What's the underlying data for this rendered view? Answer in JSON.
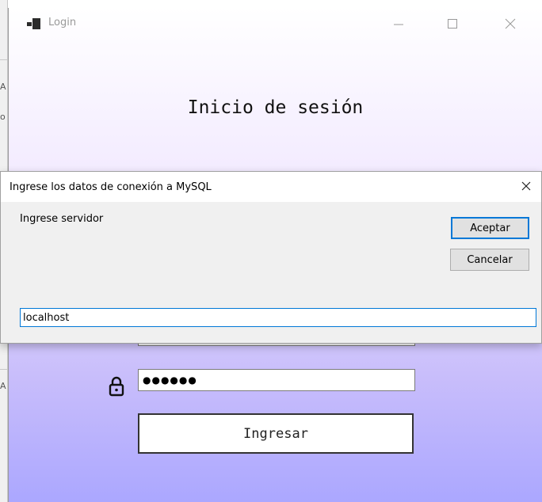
{
  "background_window": {
    "edge_glyphs": [
      "A",
      "o",
      "A"
    ]
  },
  "login_window": {
    "title": "Login",
    "heading": "Inicio de sesión",
    "password_masked": "●●●●●●",
    "login_button_label": "Ingresar",
    "icons": [
      "app-icon",
      "minimize-icon",
      "maximize-icon",
      "close-icon",
      "lock-icon"
    ]
  },
  "dialog": {
    "title": "Ingrese los datos de conexión a MySQL",
    "prompt": "Ingrese servidor",
    "accept_label": "Aceptar",
    "cancel_label": "Cancelar",
    "server_value": "localhost",
    "icons": [
      "close-icon"
    ],
    "accent_color": "#0078d7"
  }
}
